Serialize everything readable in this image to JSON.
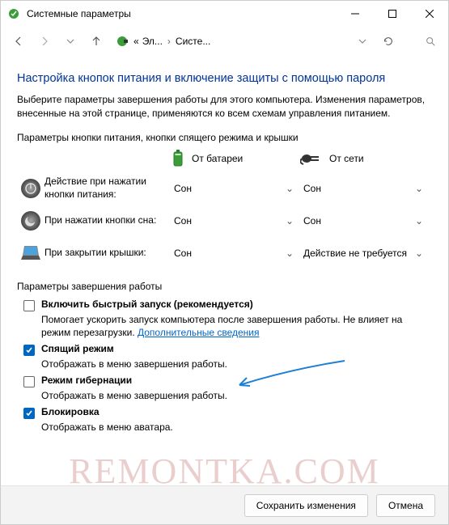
{
  "window": {
    "title": "Системные параметры"
  },
  "breadcrumb": {
    "item1": "Эл...",
    "item2": "Систе..."
  },
  "heading": "Настройка кнопок питания и включение защиты с помощью пароля",
  "intro": "Выберите параметры завершения работы для этого компьютера. Изменения параметров, внесенные на этой странице, применяются ко всем схемам управления питанием.",
  "button_section_label": "Параметры кнопки питания, кнопки спящего режима и крышки",
  "columns": {
    "battery": "От батареи",
    "ac": "От сети"
  },
  "rows": {
    "power_button": {
      "label": "Действие при нажатии кнопки питания:",
      "battery": "Сон",
      "ac": "Сон"
    },
    "sleep_button": {
      "label": "При нажатии кнопки сна:",
      "battery": "Сон",
      "ac": "Сон"
    },
    "lid": {
      "label": "При закрытии крышки:",
      "battery": "Сон",
      "ac": "Действие не требуется"
    }
  },
  "shutdown_section_label": "Параметры завершения работы",
  "options": {
    "fast_startup": {
      "label": "Включить быстрый запуск (рекомендуется)",
      "desc_prefix": "Помогает ускорить запуск компьютера после завершения работы. Не влияет на режим перезагрузки. ",
      "link": "Дополнительные сведения",
      "checked": false
    },
    "sleep": {
      "label": "Спящий режим",
      "desc": "Отображать в меню завершения работы.",
      "checked": true
    },
    "hibernate": {
      "label": "Режим гибернации",
      "desc": "Отображать в меню завершения работы.",
      "checked": false
    },
    "lock": {
      "label": "Блокировка",
      "desc": "Отображать в меню аватара.",
      "checked": true
    }
  },
  "footer": {
    "save": "Сохранить изменения",
    "cancel": "Отмена"
  },
  "watermark": "REMONTKA.COM"
}
